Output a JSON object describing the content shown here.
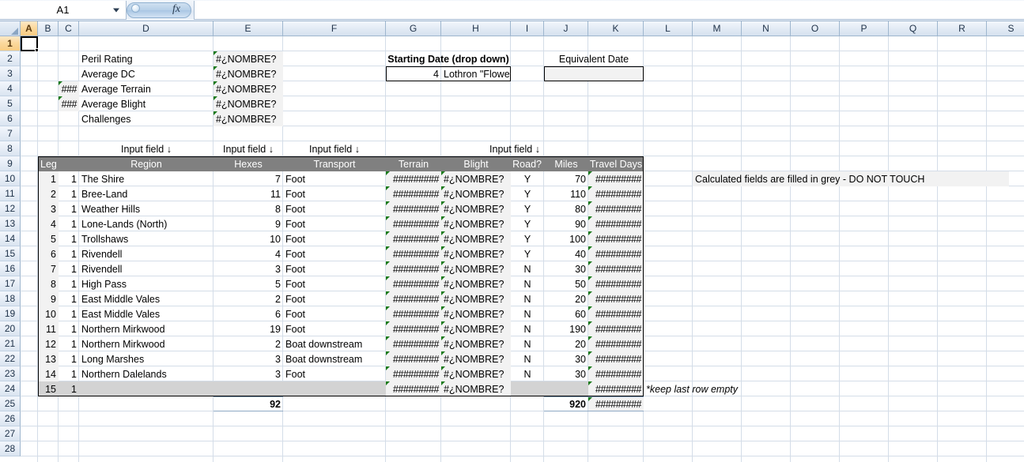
{
  "app": {
    "namebox_value": "A1",
    "formula_value": "",
    "fx_label": "fx"
  },
  "columns": [
    {
      "id": "A",
      "label": "A",
      "selected": true
    },
    {
      "id": "B",
      "label": "B",
      "selected": false
    },
    {
      "id": "C",
      "label": "C",
      "selected": false
    },
    {
      "id": "D",
      "label": "D",
      "selected": false
    },
    {
      "id": "E",
      "label": "E",
      "selected": false
    },
    {
      "id": "F",
      "label": "F",
      "selected": false
    },
    {
      "id": "G",
      "label": "G",
      "selected": false
    },
    {
      "id": "H",
      "label": "H",
      "selected": false
    },
    {
      "id": "I",
      "label": "I",
      "selected": false
    },
    {
      "id": "J",
      "label": "J",
      "selected": false
    },
    {
      "id": "K",
      "label": "K",
      "selected": false
    },
    {
      "id": "L",
      "label": "L",
      "selected": false
    },
    {
      "id": "M",
      "label": "M",
      "selected": false
    },
    {
      "id": "N",
      "label": "N",
      "selected": false
    },
    {
      "id": "O",
      "label": "O",
      "selected": false
    },
    {
      "id": "P",
      "label": "P",
      "selected": false
    },
    {
      "id": "Q",
      "label": "Q",
      "selected": false
    },
    {
      "id": "R",
      "label": "R",
      "selected": false
    },
    {
      "id": "S",
      "label": "S",
      "selected": false
    }
  ],
  "rows": [
    {
      "n": "1",
      "selected": true
    },
    {
      "n": "2",
      "selected": false
    },
    {
      "n": "3",
      "selected": false
    },
    {
      "n": "4",
      "selected": false
    },
    {
      "n": "5",
      "selected": false
    },
    {
      "n": "6",
      "selected": false
    },
    {
      "n": "7",
      "selected": false
    },
    {
      "n": "8",
      "selected": false
    },
    {
      "n": "9",
      "selected": false
    },
    {
      "n": "10",
      "selected": false
    },
    {
      "n": "11",
      "selected": false
    },
    {
      "n": "12",
      "selected": false
    },
    {
      "n": "13",
      "selected": false
    },
    {
      "n": "14",
      "selected": false
    },
    {
      "n": "15",
      "selected": false
    },
    {
      "n": "16",
      "selected": false
    },
    {
      "n": "17",
      "selected": false
    },
    {
      "n": "18",
      "selected": false
    },
    {
      "n": "19",
      "selected": false
    },
    {
      "n": "20",
      "selected": false
    },
    {
      "n": "21",
      "selected": false
    },
    {
      "n": "22",
      "selected": false
    },
    {
      "n": "23",
      "selected": false
    },
    {
      "n": "24",
      "selected": false
    },
    {
      "n": "25",
      "selected": false
    },
    {
      "n": "26",
      "selected": false
    },
    {
      "n": "27",
      "selected": false
    },
    {
      "n": "28",
      "selected": false
    }
  ],
  "summary": {
    "error_value": "#¿NOMBRE?",
    "hash_value": "###",
    "items": [
      {
        "label": "Peril Rating",
        "marker": "",
        "value": "#¿NOMBRE?"
      },
      {
        "label": "Average DC",
        "marker": "",
        "value": "#¿NOMBRE?"
      },
      {
        "label": "Average Terrain",
        "marker": "###",
        "value": "#¿NOMBRE?"
      },
      {
        "label": "Average Blight",
        "marker": "###",
        "value": "#¿NOMBRE?"
      },
      {
        "label": "Challenges",
        "marker": "",
        "value": "#¿NOMBRE?"
      }
    ]
  },
  "date_panel": {
    "starting_date_label": "Starting Date (drop down)",
    "equivalent_date_label": "Equivalent Date",
    "starting_date_number": "4",
    "starting_date_name": "Lothron \"Flowering\"",
    "equivalent_date_value": ""
  },
  "input_markers": {
    "region": "Input field ↓",
    "hexes": "Input field ↓",
    "transport": "Input field ↓",
    "road": "Input field ↓"
  },
  "table": {
    "headers": [
      "Leg",
      "Region",
      "Hexes",
      "Transport",
      "Terrain",
      "Blight",
      "Road?",
      "Miles",
      "Travel Days"
    ],
    "rows": [
      {
        "leg": "1",
        "c": "1",
        "region": "The Shire",
        "hexes": "7",
        "transport": "Foot",
        "terrain": "#########",
        "blight": "#¿NOMBRE?",
        "road": "Y",
        "miles": "70",
        "days": "#########"
      },
      {
        "leg": "2",
        "c": "1",
        "region": "Bree-Land",
        "hexes": "11",
        "transport": "Foot",
        "terrain": "#########",
        "blight": "#¿NOMBRE?",
        "road": "Y",
        "miles": "110",
        "days": "#########"
      },
      {
        "leg": "3",
        "c": "1",
        "region": "Weather Hills",
        "hexes": "8",
        "transport": "Foot",
        "terrain": "#########",
        "blight": "#¿NOMBRE?",
        "road": "Y",
        "miles": "80",
        "days": "#########"
      },
      {
        "leg": "4",
        "c": "1",
        "region": "Lone-Lands (North)",
        "hexes": "9",
        "transport": "Foot",
        "terrain": "#########",
        "blight": "#¿NOMBRE?",
        "road": "Y",
        "miles": "90",
        "days": "#########"
      },
      {
        "leg": "5",
        "c": "1",
        "region": "Trollshaws",
        "hexes": "10",
        "transport": "Foot",
        "terrain": "#########",
        "blight": "#¿NOMBRE?",
        "road": "Y",
        "miles": "100",
        "days": "#########"
      },
      {
        "leg": "6",
        "c": "1",
        "region": "Rivendell",
        "hexes": "4",
        "transport": "Foot",
        "terrain": "#########",
        "blight": "#¿NOMBRE?",
        "road": "Y",
        "miles": "40",
        "days": "#########"
      },
      {
        "leg": "7",
        "c": "1",
        "region": "Rivendell",
        "hexes": "3",
        "transport": "Foot",
        "terrain": "#########",
        "blight": "#¿NOMBRE?",
        "road": "N",
        "miles": "30",
        "days": "#########"
      },
      {
        "leg": "8",
        "c": "1",
        "region": "High Pass",
        "hexes": "5",
        "transport": "Foot",
        "terrain": "#########",
        "blight": "#¿NOMBRE?",
        "road": "N",
        "miles": "50",
        "days": "#########"
      },
      {
        "leg": "9",
        "c": "1",
        "region": "East Middle Vales",
        "hexes": "2",
        "transport": "Foot",
        "terrain": "#########",
        "blight": "#¿NOMBRE?",
        "road": "N",
        "miles": "20",
        "days": "#########"
      },
      {
        "leg": "10",
        "c": "1",
        "region": "East Middle Vales",
        "hexes": "6",
        "transport": "Foot",
        "terrain": "#########",
        "blight": "#¿NOMBRE?",
        "road": "N",
        "miles": "60",
        "days": "#########"
      },
      {
        "leg": "11",
        "c": "1",
        "region": "Northern Mirkwood",
        "hexes": "19",
        "transport": "Foot",
        "terrain": "#########",
        "blight": "#¿NOMBRE?",
        "road": "N",
        "miles": "190",
        "days": "#########"
      },
      {
        "leg": "12",
        "c": "1",
        "region": "Northern Mirkwood",
        "hexes": "2",
        "transport": "Boat downstream",
        "terrain": "#########",
        "blight": "#¿NOMBRE?",
        "road": "N",
        "miles": "20",
        "days": "#########"
      },
      {
        "leg": "13",
        "c": "1",
        "region": "Long Marshes",
        "hexes": "3",
        "transport": "Boat downstream",
        "terrain": "#########",
        "blight": "#¿NOMBRE?",
        "road": "N",
        "miles": "30",
        "days": "#########"
      },
      {
        "leg": "14",
        "c": "1",
        "region": "Northern Dalelands",
        "hexes": "3",
        "transport": "Foot",
        "terrain": "#########",
        "blight": "#¿NOMBRE?",
        "road": "N",
        "miles": "30",
        "days": "#########"
      },
      {
        "leg": "15",
        "c": "1",
        "region": "",
        "hexes": "",
        "transport": "",
        "terrain": "#########",
        "blight": "#¿NOMBRE?",
        "road": "",
        "miles": "",
        "days": "#########"
      }
    ],
    "totals": {
      "hexes": "92",
      "miles": "920",
      "days": "#########"
    }
  },
  "notes": {
    "calculated": "Calculated fields are filled in grey - DO NOT TOUCH",
    "last_row": "*keep last row empty"
  }
}
